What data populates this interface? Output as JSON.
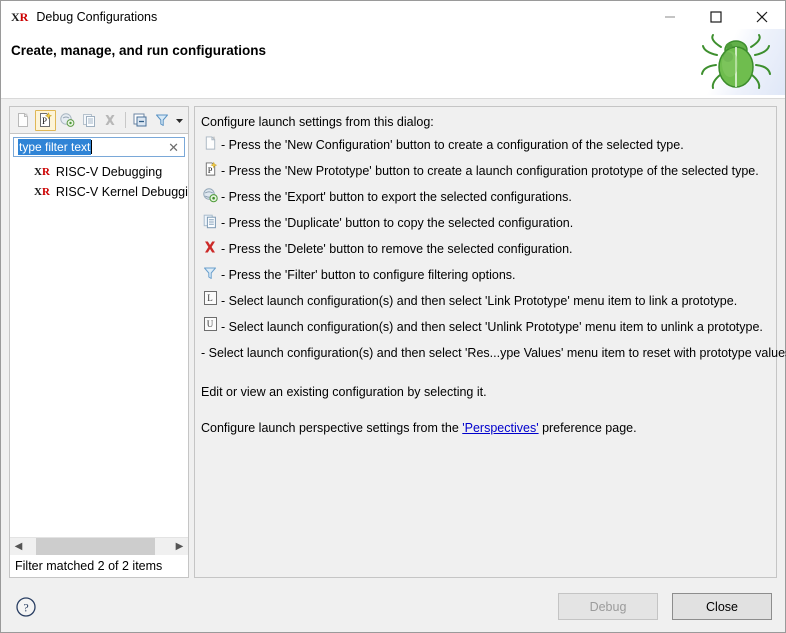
{
  "window": {
    "title": "Debug Configurations",
    "app_icon": "xr-icon",
    "controls": {
      "minimize": "minimize-icon",
      "maximize": "maximize-icon",
      "close": "close-icon"
    }
  },
  "header": {
    "title": "Create, manage, and run configurations",
    "banner_icon": "green-bug-icon"
  },
  "toolbar": {
    "buttons": [
      {
        "name": "new-configuration-button",
        "icon": "new-configuration-icon",
        "enabled": false
      },
      {
        "name": "new-prototype-button",
        "icon": "new-prototype-icon",
        "enabled": true
      },
      {
        "name": "export-button",
        "icon": "export-icon",
        "enabled": false
      },
      {
        "name": "duplicate-button",
        "icon": "duplicate-icon",
        "enabled": false
      },
      {
        "name": "delete-button",
        "icon": "delete-icon",
        "enabled": false
      },
      {
        "name": "collapse-all-button",
        "icon": "collapse-all-icon",
        "enabled": true
      },
      {
        "name": "filter-button",
        "icon": "filter-icon",
        "enabled": true
      },
      {
        "name": "view-menu-button",
        "icon": "chevron-down-icon",
        "enabled": true
      }
    ]
  },
  "filter": {
    "value": "type filter text",
    "placeholder": "type filter text",
    "clear_icon": "clear-icon",
    "selected": true
  },
  "tree": {
    "items": [
      {
        "icon": "xr-icon",
        "label": "RISC-V Debugging"
      },
      {
        "icon": "xr-icon",
        "label": "RISC-V Kernel Debuggin‰"
      }
    ],
    "status": "Filter matched 2 of 2 items",
    "scrollbar": {
      "left_arrow": "chevron-left-icon",
      "right_arrow": "chevron-right-icon"
    }
  },
  "main": {
    "intro": "Configure launch settings from this dialog:",
    "hints": [
      {
        "icon": "new-configuration-icon",
        "text": "- Press the 'New Configuration' button to create a configuration of the selected type."
      },
      {
        "icon": "new-prototype-icon",
        "text": "- Press the 'New Prototype' button to create a launch configuration prototype of the selected type."
      },
      {
        "icon": "export-icon",
        "text": "- Press the 'Export' button to export the selected configurations."
      },
      {
        "icon": "duplicate-icon",
        "text": "- Press the 'Duplicate' button to copy the selected configuration."
      },
      {
        "icon": "delete-icon",
        "text": "- Press the 'Delete' button to remove the selected configuration."
      },
      {
        "icon": "filter-icon",
        "text": "- Press the 'Filter' button to configure filtering options."
      },
      {
        "icon": "link-prototype-icon",
        "text": "- Select launch configuration(s) and then select 'Link Prototype' menu item to link a prototype."
      },
      {
        "icon": "unlink-prototype-icon",
        "text": "- Select launch configuration(s) and then select 'Unlink Prototype' menu item to unlink a prototype."
      },
      {
        "icon": "none",
        "text": "- Select launch configuration(s) and then select 'Res...ype Values' menu item to reset with prototype values."
      }
    ],
    "edit_note": "Edit or view an existing configuration by selecting it.",
    "perspective_note_before": "Configure launch perspective settings from the ",
    "perspective_link": "'Perspectives'",
    "perspective_note_after": " preference page."
  },
  "footer": {
    "help_icon": "help-icon",
    "debug_label": "Debug",
    "close_label": "Close"
  },
  "colors": {
    "accent_blue": "#2f84d6",
    "link_blue": "#0000cc",
    "delete_red": "#cc2a28",
    "bug_green": "#4ca832",
    "panel_bg": "#f0f0f0",
    "border": "#c5c5c5"
  }
}
